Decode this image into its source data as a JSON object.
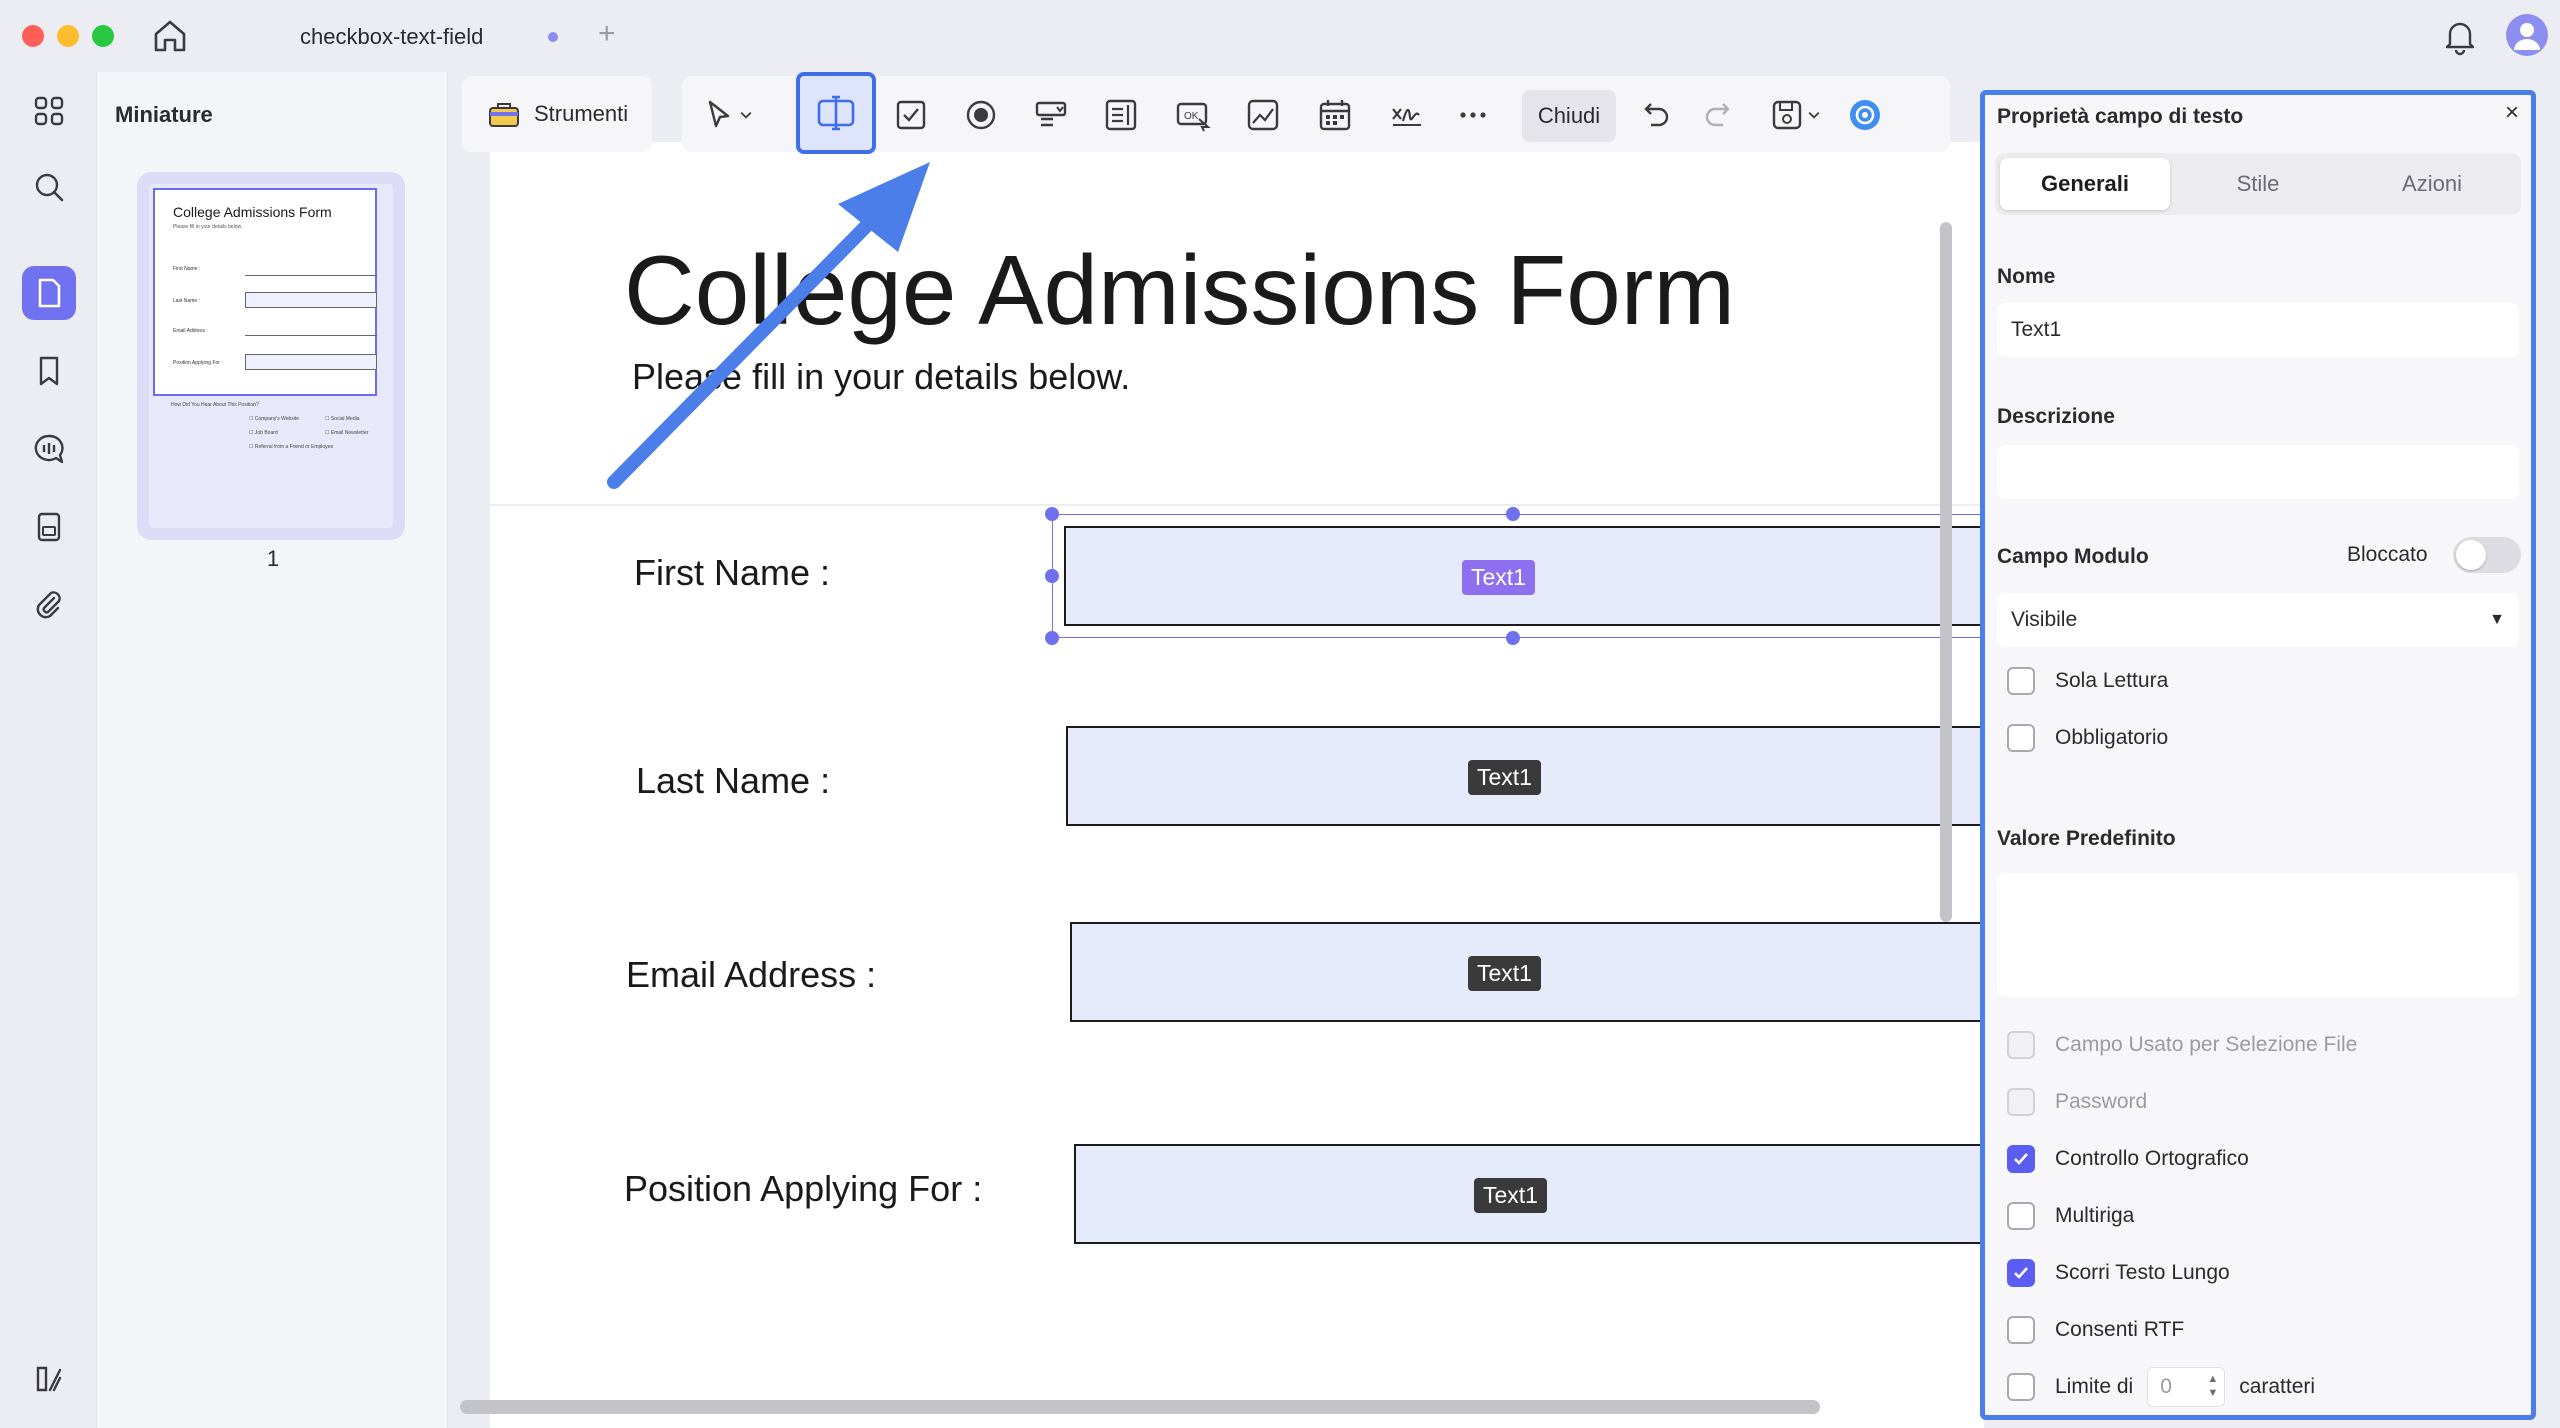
{
  "tab": {
    "title": "checkbox-text-field"
  },
  "thumbnails": {
    "title": "Miniature",
    "page_number": "1",
    "preview": {
      "title": "College Admissions Form",
      "subtitle": "Please fill in your details below.",
      "rows": [
        "First Name :",
        "Last Name :",
        "Email Address :",
        "Position Applying For :"
      ],
      "question": "How Did You Hear About This Position?",
      "options": [
        "Company's Website",
        "Social Media",
        "Job Board",
        "Email Newsletter",
        "Referral from a Friend or Employee"
      ]
    }
  },
  "toolbar": {
    "tools_label": "Strumenti",
    "close_label": "Chiudi"
  },
  "document": {
    "title": "College Admissions Form",
    "subtitle": "Please fill in your details below.",
    "fields": [
      {
        "label": "First Name :",
        "badge": "Text1"
      },
      {
        "label": "Last Name :",
        "badge": "Text1"
      },
      {
        "label": "Email Address :",
        "badge": "Text1"
      },
      {
        "label": "Position Applying For :",
        "badge": "Text1"
      }
    ]
  },
  "panel": {
    "title": "Proprietà campo di testo",
    "close": "×",
    "tabs": [
      "Generali",
      "Stile",
      "Azioni"
    ],
    "name_label": "Nome",
    "name_value": "Text1",
    "description_label": "Descrizione",
    "description_value": "",
    "form_field_label": "Campo Modulo",
    "locked_label": "Bloccato",
    "visibility_value": "Visibile",
    "read_only_label": "Sola Lettura",
    "required_label": "Obbligatorio",
    "default_value_label": "Valore Predefinito",
    "default_value": "",
    "file_select_label": "Campo Usato per Selezione File",
    "password_label": "Password",
    "spell_check_label": "Controllo Ortografico",
    "multiline_label": "Multiriga",
    "scroll_long_label": "Scorri Testo Lungo",
    "rtf_label": "Consenti RTF",
    "limit_prefix": "Limite di",
    "limit_value": "0",
    "limit_suffix": "caratteri"
  },
  "colors": {
    "accent": "#6e70f0",
    "panel_border": "#4a7ee8",
    "field_fill": "#e6ebfc"
  }
}
